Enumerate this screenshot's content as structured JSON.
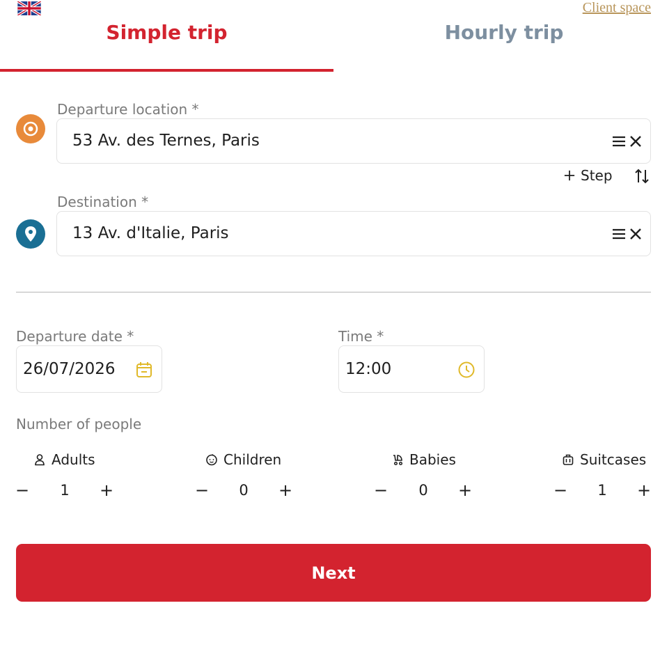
{
  "header": {
    "client_link": "Client space",
    "flag_icon": "uk-flag-icon"
  },
  "tabs": [
    {
      "label": "Simple trip",
      "active": true
    },
    {
      "label": "Hourly trip",
      "active": false
    }
  ],
  "colors": {
    "accent": "#d3232f",
    "tab_inactive": "#7d8fa0",
    "departure_pin": "#e88a3a",
    "destination_pin": "#1a6f94",
    "date_icon": "#e0b92a",
    "link": "#b8955a"
  },
  "departure": {
    "label": "Departure location *",
    "value": "53 Av. des Ternes, Paris",
    "icon": "origin-circle-icon"
  },
  "step": {
    "label": "Step",
    "icon": "plus-icon",
    "swap_icon": "swap-vertical-icon"
  },
  "destination": {
    "label": "Destination *",
    "value": "13 Av. d'Italie, Paris",
    "icon": "map-pin-icon"
  },
  "departure_date": {
    "label": "Departure date *",
    "value": "26/07/2026",
    "icon": "calendar-icon"
  },
  "time": {
    "label": "Time *",
    "value": "12:00",
    "icon": "clock-icon"
  },
  "people": {
    "label": "Number of people",
    "counters": [
      {
        "label": "Adults",
        "value": "1",
        "icon": "person-icon"
      },
      {
        "label": "Children",
        "value": "0",
        "icon": "child-face-icon"
      },
      {
        "label": "Babies",
        "value": "0",
        "icon": "stroller-icon"
      },
      {
        "label": "Suitcases",
        "value": "1",
        "icon": "suitcase-icon"
      }
    ],
    "minus": "−",
    "plus": "+"
  },
  "next_button": "Next"
}
